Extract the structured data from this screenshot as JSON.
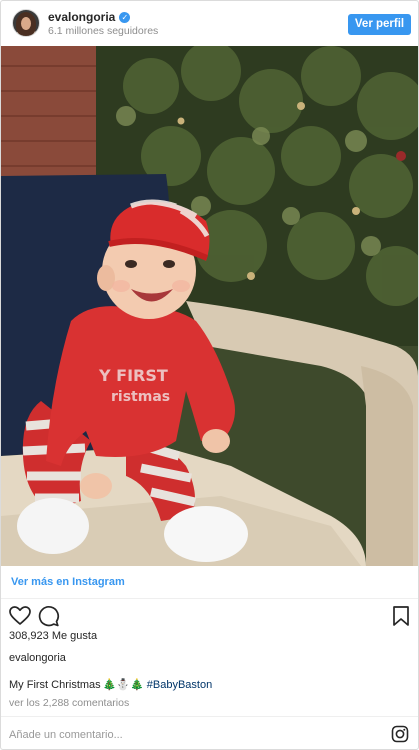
{
  "header": {
    "username": "evalongoria",
    "followers": "6.1 millones seguidores",
    "follow_button": "Ver perfil",
    "verified_glyph": "✓"
  },
  "view_more": "Ver más en Instagram",
  "actions": {
    "like_icon": "heart-icon",
    "comment_icon": "comment-icon",
    "save_icon": "bookmark-icon"
  },
  "post": {
    "likes": "308,923 Me gusta",
    "author": "evalongoria",
    "caption_text": "My First Christmas",
    "caption_emoji": "🎄⛄🎄",
    "hashtag": "#BabyBaston",
    "comments_link": "ver los 2,288 comentarios"
  },
  "comment_bar": {
    "placeholder": "Añade un comentario..."
  },
  "colors": {
    "accent": "#3897f0",
    "hashtag": "#003569",
    "muted": "#8e8e8e"
  }
}
